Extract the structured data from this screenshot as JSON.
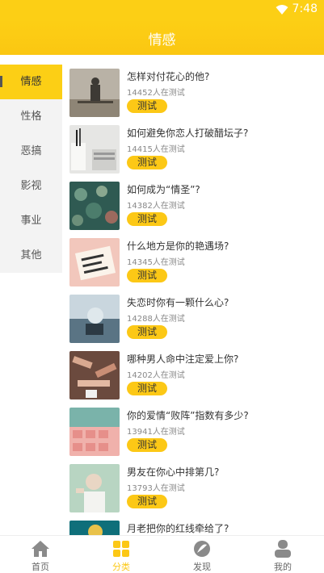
{
  "status": {
    "time": "7:48"
  },
  "header": {
    "title": "情感"
  },
  "sidebar": {
    "items": [
      {
        "label": "情感",
        "active": true
      },
      {
        "label": "性格"
      },
      {
        "label": "恶搞"
      },
      {
        "label": "影视"
      },
      {
        "label": "事业"
      },
      {
        "label": "其他"
      }
    ]
  },
  "list": {
    "button_label": "测试",
    "items": [
      {
        "title": "怎样对付花心的他?",
        "count": "14452人在测试"
      },
      {
        "title": "如何避免你恋人打破醋坛子?",
        "count": "14415人在测试"
      },
      {
        "title": "如何成为“情圣”?",
        "count": "14382人在测试"
      },
      {
        "title": "什么地方是你的艳遇场?",
        "count": "14345人在测试"
      },
      {
        "title": "失恋时你有一颗什么心?",
        "count": "14288人在测试"
      },
      {
        "title": "哪种男人命中注定爱上你?",
        "count": "14202人在测试"
      },
      {
        "title": "你的爱情“败阵”指数有多少?",
        "count": "13941人在测试"
      },
      {
        "title": "男友在你心中排第几?",
        "count": "13793人在测试"
      },
      {
        "title": "月老把你的红线牵给了?",
        "count": ""
      }
    ]
  },
  "tabbar": {
    "items": [
      {
        "label": "首页",
        "icon": "home-icon"
      },
      {
        "label": "分类",
        "icon": "category-icon",
        "active": true
      },
      {
        "label": "发现",
        "icon": "discover-icon"
      },
      {
        "label": "我的",
        "icon": "profile-icon"
      }
    ]
  },
  "colors": {
    "accent": "#fccf15",
    "button": "#fcc816",
    "active_tab": "#fcc816"
  }
}
